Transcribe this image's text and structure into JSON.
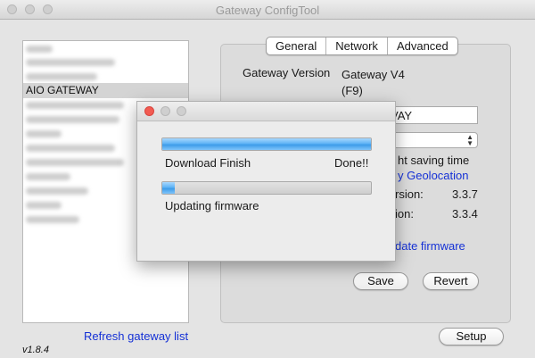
{
  "window": {
    "title": "Gateway ConfigTool"
  },
  "gateway_list": {
    "selected_label": "AIO GATEWAY",
    "refresh_link": "Refresh gateway list",
    "version": "v1.8.4"
  },
  "tabs": [
    {
      "label": "General"
    },
    {
      "label": "Network"
    },
    {
      "label": "Advanced"
    }
  ],
  "general": {
    "gateway_version_label": "Gateway Version",
    "gateway_version_value": "Gateway V4",
    "gateway_version_sub": "(F9)",
    "name_field_value": "VAY",
    "daylight_label": "ht saving time",
    "geolocation_link": "y Geolocation",
    "version1_label": "rsion:",
    "version1_value": "3.3.7",
    "version2_label": "ion:",
    "version2_value": "3.3.4",
    "update_link": "date firmware",
    "save_label": "Save",
    "revert_label": "Revert"
  },
  "setup_label": "Setup",
  "dialog": {
    "download_label": "Download Finish",
    "download_status": "Done!!",
    "download_progress": 1.0,
    "update_label": "Updating firmware",
    "update_progress": 0.06
  },
  "colors": {
    "link": "#1531d6",
    "progress": "#4aa3ee",
    "close_button": "#f25b52"
  }
}
